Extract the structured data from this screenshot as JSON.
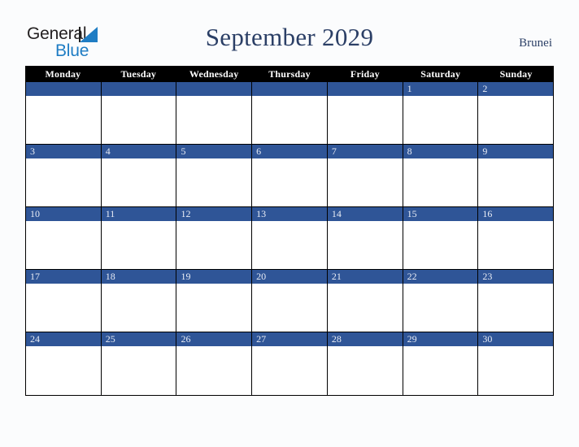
{
  "brand": {
    "word_one": "General",
    "word_two": "Blue",
    "triangle_icon": "blue-triangle-icon",
    "colors": {
      "dark_text": "#231f20",
      "blue_text": "#1f7dc4"
    }
  },
  "header": {
    "title": "September 2029",
    "country": "Brunei"
  },
  "theme": {
    "weekday_header_bg": "#000000",
    "weekday_header_text": "#ffffff",
    "date_bar_bg": "#2f5597",
    "date_text": "#e8ecf5",
    "cell_bg": "#ffffff",
    "page_bg": "#fbfcfd",
    "title_color": "#2b3f66",
    "grid_line": "#000000"
  },
  "calendar": {
    "month": "September",
    "year": "2029",
    "weekdays": [
      "Monday",
      "Tuesday",
      "Wednesday",
      "Thursday",
      "Friday",
      "Saturday",
      "Sunday"
    ],
    "weeks": [
      {
        "days": [
          {
            "number": ""
          },
          {
            "number": ""
          },
          {
            "number": ""
          },
          {
            "number": ""
          },
          {
            "number": ""
          },
          {
            "number": "1"
          },
          {
            "number": "2"
          }
        ]
      },
      {
        "days": [
          {
            "number": "3"
          },
          {
            "number": "4"
          },
          {
            "number": "5"
          },
          {
            "number": "6"
          },
          {
            "number": "7"
          },
          {
            "number": "8"
          },
          {
            "number": "9"
          }
        ]
      },
      {
        "days": [
          {
            "number": "10"
          },
          {
            "number": "11"
          },
          {
            "number": "12"
          },
          {
            "number": "13"
          },
          {
            "number": "14"
          },
          {
            "number": "15"
          },
          {
            "number": "16"
          }
        ]
      },
      {
        "days": [
          {
            "number": "17"
          },
          {
            "number": "18"
          },
          {
            "number": "19"
          },
          {
            "number": "20"
          },
          {
            "number": "21"
          },
          {
            "number": "22"
          },
          {
            "number": "23"
          }
        ]
      },
      {
        "days": [
          {
            "number": "24"
          },
          {
            "number": "25"
          },
          {
            "number": "26"
          },
          {
            "number": "27"
          },
          {
            "number": "28"
          },
          {
            "number": "29"
          },
          {
            "number": "30"
          }
        ]
      }
    ]
  }
}
